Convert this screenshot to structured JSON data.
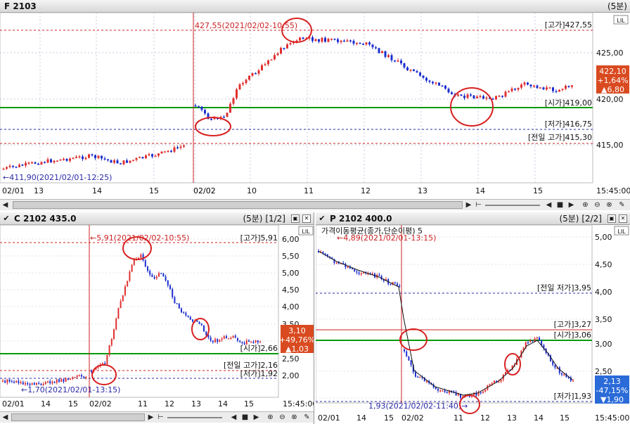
{
  "top": {
    "title": "F 2103",
    "period": "(5분)",
    "y_ticks": [
      "425,00",
      "420,00",
      "415,00"
    ],
    "x_labels": [
      "02/01",
      "13",
      "14",
      "15",
      "02/02",
      "10",
      "11",
      "12",
      "13",
      "14",
      "15",
      "15:45:00"
    ],
    "ann_high_marker": "427,55(2021/02/02-10:55)",
    "ann_low_marker": "411,90(2021/02/01-12:25)",
    "ref_high": "[고가]427,55",
    "ref_open": "[시가]419,00",
    "ref_low": "[저가]416,75",
    "ref_prev_high": "[전일 고가]415,30",
    "price_box": {
      "price": "422,10",
      "pct": "+1,64%",
      "change": "▲6,80"
    }
  },
  "bl": {
    "title": "C 2102 435.0",
    "period": "(5분)",
    "page": "[1/2]",
    "y_ticks": [
      "6,00",
      "5,50",
      "5,00",
      "4,50",
      "4,00",
      "3,50",
      "3,00",
      "2,50",
      "2,00"
    ],
    "x_labels": [
      "02/01",
      "14",
      "15",
      "02/02",
      "11",
      "12",
      "13",
      "14",
      "15",
      "15:45:00"
    ],
    "ann_high_marker": "5,91(2021/02/02-10:55)",
    "ann_low_marker": "1,70(2021/02/01-13:15)",
    "ref_high": "[고가]5,91",
    "ref_open": "[시가]2,66",
    "ref_prev_high": "[전일 고가]2,16",
    "ref_low": "[저가]1,92",
    "price_box": {
      "price": "3,10",
      "pct": "+49,76%",
      "change": "▲1,03"
    }
  },
  "br": {
    "title": "P 2102 400.0",
    "period": "(5분)",
    "page": "[2/2]",
    "indicator": "가격이동평균(종가,단순이평) 5",
    "y_ticks": [
      "5,00",
      "4,50",
      "4,00",
      "3,50",
      "3,00",
      "2,50",
      "2,00"
    ],
    "x_labels": [
      "02/01",
      "14",
      "15",
      "02/02",
      "11",
      "12",
      "13",
      "14",
      "15",
      "15:45:00"
    ],
    "ann_high_marker": "4,89(2021/02/01-13:15)",
    "ann_low_marker": "1,93(2021/02/02-11:40)",
    "ref_prev_low": "[전일 저가]3,95",
    "ref_high": "[고가]3,27",
    "ref_open": "[시가]3,06",
    "ref_low": "[저가]1,93",
    "price_box": {
      "price": "2,13",
      "pct": "-47,15%",
      "change": "▼1,90"
    }
  },
  "colors": {
    "up": "#e03030",
    "down": "#1c2fd0",
    "open_line": "#0a9a0a",
    "ref_line": "#cc2222",
    "low_line": "#2a2aa8",
    "circle": "#d82020"
  }
}
